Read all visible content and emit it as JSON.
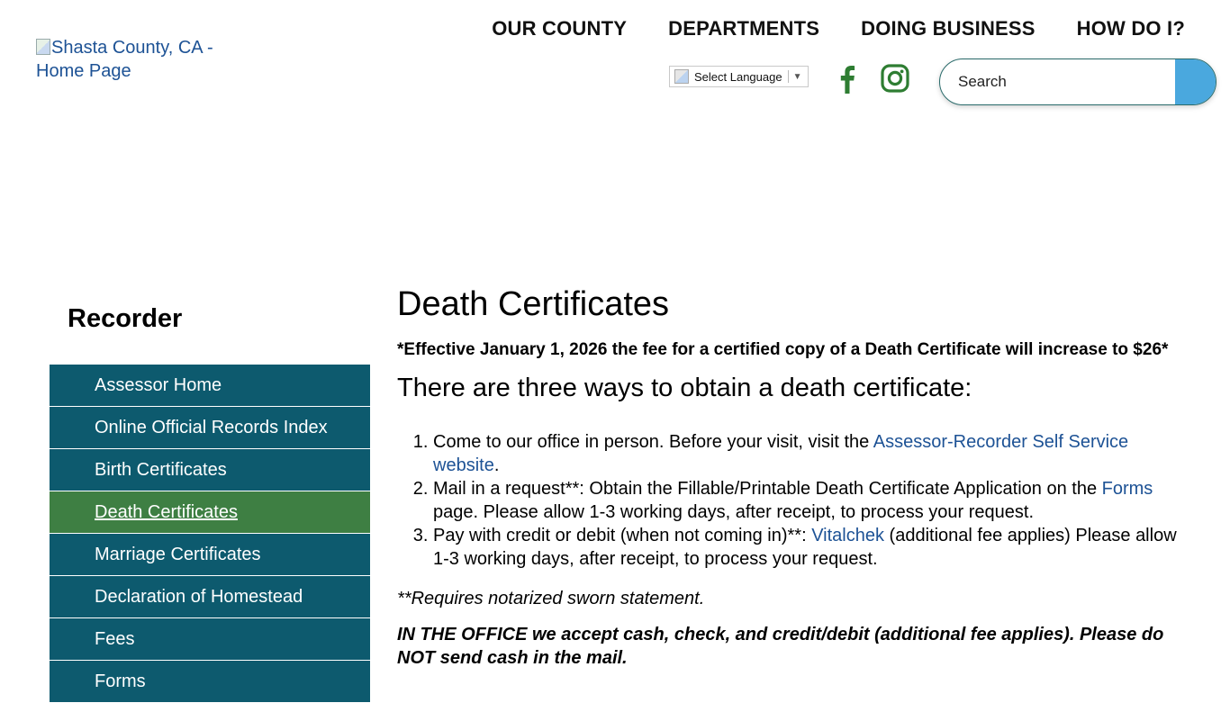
{
  "header": {
    "logo_alt": "Shasta County, CA - Home Page",
    "nav": [
      "OUR COUNTY",
      "DEPARTMENTS",
      "DOING BUSINESS",
      "HOW DO I?"
    ],
    "translate_label": "Select Language",
    "translate_arrow": "▼",
    "search_placeholder": "Search",
    "social_icons": [
      "facebook-icon",
      "instagram-icon"
    ],
    "colors": {
      "icon_green": "#2e7d32",
      "search_button": "#4aa8de"
    }
  },
  "sidebar": {
    "title": "Recorder",
    "items": [
      {
        "label": "Assessor Home"
      },
      {
        "label": "Online Official Records Index"
      },
      {
        "label": "Birth Certificates"
      },
      {
        "label": "Death Certificates"
      },
      {
        "label": "Marriage Certificates"
      },
      {
        "label": "Declaration of Homestead"
      },
      {
        "label": "Fees"
      },
      {
        "label": "Forms"
      }
    ],
    "active_index": 3,
    "colors": {
      "item_bg": "#0d5a6e",
      "active_bg": "#3e7f43"
    }
  },
  "main": {
    "title": "Death Certificates",
    "notice": "*Effective January 1, 2026 the fee for a certified copy of a Death Certificate will increase to $26*",
    "subheading": "There are three ways to obtain a death certificate:",
    "ways": [
      {
        "pre": "Come to our office in person. Before your visit, visit the ",
        "link": "Assessor-Recorder Self Service website",
        "post": "."
      },
      {
        "pre": "Mail in a request**: Obtain the Fillable/Printable Death Certificate Application on the ",
        "link": "Forms",
        "post": " page. Please allow 1-3 working days, after receipt, to process your request."
      },
      {
        "pre": "Pay with credit or debit (when not coming in)**: ",
        "link": "Vitalchek",
        "post": " (additional fee applies) Please allow 1-3 working days, after receipt, to process your request."
      }
    ],
    "note": "**Requires notarized sworn statement.",
    "office_text": "IN THE OFFICE we accept cash, check, and credit/debit (additional fee applies). Please do NOT send cash in the mail."
  }
}
